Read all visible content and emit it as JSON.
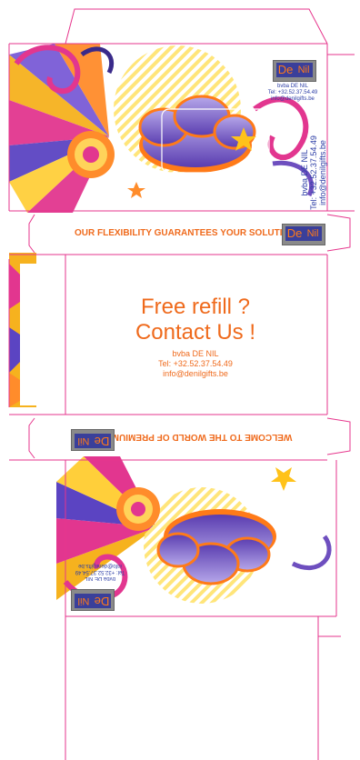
{
  "company": {
    "name": "bvba DE NIL",
    "phone": "Tel: +32.52.37.54.49",
    "email": "info@denilgifts.be"
  },
  "logo": {
    "left": "De",
    "right": "Nil"
  },
  "slogans": {
    "top": "OUR FLEXIBILITY GUARANTEES YOUR SOLUTIONS",
    "bottom": "WELCOME TO THE WORLD OF PREMIUMS"
  },
  "headline": {
    "line1": "Free refill ?",
    "line2": "Contact Us !"
  },
  "colors": {
    "dieline": "#e6358c",
    "orange": "#ef6a1c",
    "blue": "#2d3ea6",
    "purple": "#6e4fbf",
    "yellow": "#ffe27a",
    "pink": "#e2368f"
  }
}
